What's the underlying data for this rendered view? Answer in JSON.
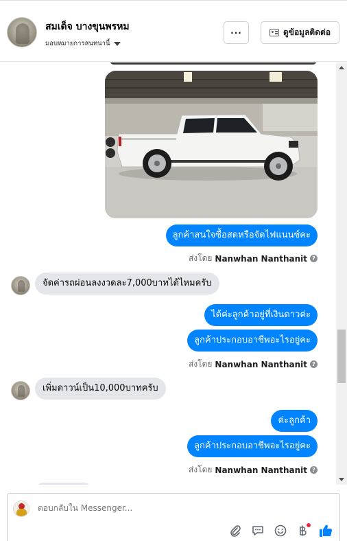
{
  "header": {
    "page_name": "สมเด็จ บางขุนพรหม",
    "assign_label": "มอบหมายการสนทนานี้",
    "more_button": "···",
    "contact_button": "ดูข้อมูลติดต่อ"
  },
  "messages": {
    "out_1": "ลูกค้าสนใจซื้อสดหรือจัดไฟแนนซ์คะ",
    "sent_by_1": {
      "prefix": "ส่งโดย",
      "name": "Nanwhan Nanthanit"
    },
    "in_1": "จัดค่ารถผ่อนลงงวดละ7,000บาทได้ไหมครับ",
    "out_2": "ได้ค่ะลูกค้าอยู่ที่เงินดาวค่ะ",
    "out_3": "ลูกค้าประกอบอาชีพอะไรอยู่คะ",
    "sent_by_2": {
      "prefix": "ส่งโดย",
      "name": "Nanwhan Nanthanit"
    },
    "in_2": "เพิ่มดาวน์เป็น10,000บาทครับ",
    "out_4": "ค่ะลูกค้า",
    "out_5": "ลูกค้าประกอบอาชีพอะไรอยู่คะ",
    "sent_by_3": {
      "prefix": "ส่งโดย",
      "name": "Nanwhan Nanthanit"
    }
  },
  "composer": {
    "placeholder": "ตอบกลับใน Messenger...",
    "icons": [
      "paperclip-icon",
      "quick-reply-icon",
      "emoji-icon",
      "baht-payment-icon",
      "thumbs-up-icon"
    ]
  },
  "colors": {
    "outgoing_bubble": "#0084ff",
    "incoming_bubble": "#e4e6eb",
    "like_blue": "#0084ff"
  }
}
